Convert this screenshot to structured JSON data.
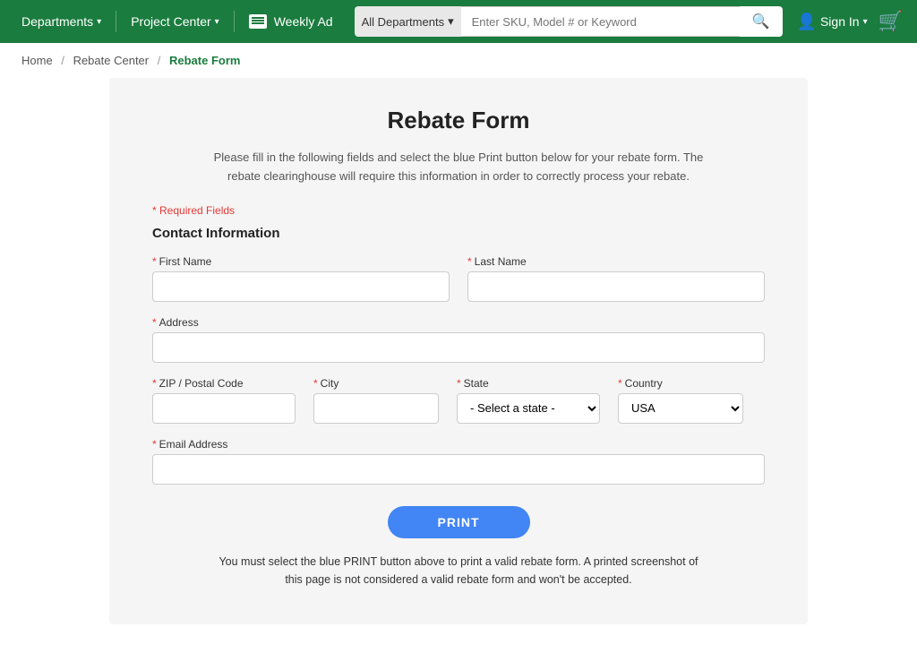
{
  "header": {
    "bg_color": "#1a7c3e",
    "nav": [
      {
        "id": "departments",
        "label": "Departments",
        "has_dropdown": true
      },
      {
        "id": "project-center",
        "label": "Project Center",
        "has_dropdown": true
      },
      {
        "id": "weekly-ad",
        "label": "Weekly Ad",
        "has_dropdown": false
      }
    ],
    "search": {
      "dept_label": "All Departments",
      "placeholder": "Enter SKU, Model # or Keyword"
    },
    "sign_in_label": "Sign In",
    "cart_icon": "🛒"
  },
  "breadcrumb": {
    "home": "Home",
    "center": "Rebate Center",
    "current": "Rebate Form"
  },
  "form": {
    "title": "Rebate Form",
    "description": "Please fill in the following fields and select the blue Print button below for your rebate form. The rebate clearinghouse will require this information in order to correctly process your rebate.",
    "required_note": "* Required Fields",
    "section_title": "Contact Information",
    "fields": {
      "first_name_label": "First Name",
      "last_name_label": "Last Name",
      "address_label": "Address",
      "zip_label": "ZIP / Postal Code",
      "city_label": "City",
      "state_label": "State",
      "country_label": "Country",
      "email_label": "Email Address"
    },
    "state_placeholder": "- Select a state -",
    "country_default": "USA",
    "print_button": "PRINT",
    "print_note": "You must select the blue PRINT button above to print a valid rebate form. A printed screenshot of this page is not considered a valid rebate form and won't be accepted."
  }
}
